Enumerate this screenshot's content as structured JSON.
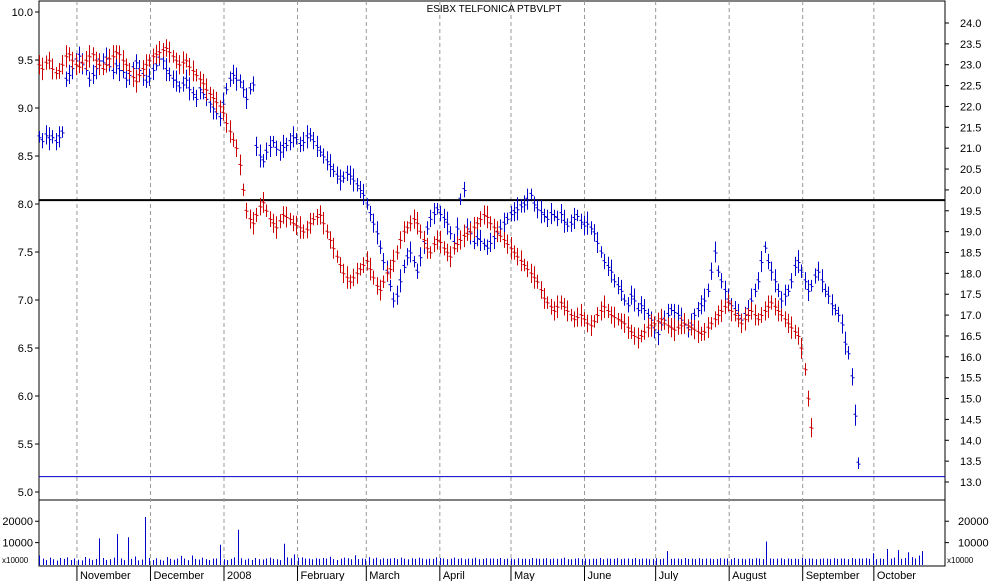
{
  "chart_data": {
    "type": "bar",
    "title": "ESIBX TELFONICA PTBVLPT",
    "x_months": [
      {
        "label": "November",
        "day": 30
      },
      {
        "label": "December",
        "day": 61
      },
      {
        "label": "2008",
        "day": 92
      },
      {
        "label": "February",
        "day": 123
      },
      {
        "label": "March",
        "day": 152
      },
      {
        "label": "April",
        "day": 183
      },
      {
        "label": "May",
        "day": 213
      },
      {
        "label": "June",
        "day": 244
      },
      {
        "label": "July",
        "day": 274
      },
      {
        "label": "August",
        "day": 305
      },
      {
        "label": "September",
        "day": 336
      },
      {
        "label": "October",
        "day": 366
      }
    ],
    "x_range_days": [
      14,
      396
    ],
    "left_axis": {
      "ylim": [
        5.0,
        10.0
      ],
      "ticks": [
        "5.0",
        "5.5",
        "6.0",
        "6.5",
        "7.0",
        "7.5",
        "8.0",
        "8.5",
        "9.0",
        "9.5",
        "10.0"
      ]
    },
    "right_axis": {
      "ylim": [
        13.0,
        24.5
      ],
      "ticks": [
        "13.0",
        "13.5",
        "14.0",
        "14.5",
        "15.0",
        "15.5",
        "16.0",
        "16.5",
        "17.0",
        "17.5",
        "18.0",
        "18.5",
        "19.0",
        "19.5",
        "20.0",
        "20.5",
        "21.0",
        "21.5",
        "22.0",
        "22.5",
        "23.0",
        "23.5",
        "24.0"
      ]
    },
    "volume": {
      "ylim": [
        0,
        29000
      ],
      "left_ticks": [
        "20000",
        "10000"
      ],
      "right_ticks": [
        "20000",
        "10000"
      ],
      "tick_values": [
        20000,
        10000
      ],
      "multiplier_label": "x10000",
      "values": [
        4000,
        2500,
        1800,
        3000,
        2200,
        1600,
        2800,
        2400,
        3100,
        1900,
        2600,
        2000,
        1700,
        3300,
        2500,
        1800,
        2400,
        12000,
        2800,
        1900,
        2200,
        3000,
        14000,
        2600,
        1800,
        12500,
        2400,
        3500,
        1700,
        2100,
        22000,
        2800,
        1900,
        2700,
        2000,
        1600,
        3200,
        2400,
        2000,
        2600,
        3800,
        2500,
        1800,
        4000,
        2400,
        2100,
        3000,
        2300,
        1900,
        2500,
        2600,
        9000,
        2200,
        1800,
        2400,
        3100,
        16000,
        2700,
        2000,
        2500,
        1900,
        2800,
        2300,
        2100,
        2600,
        3000,
        2400,
        2200,
        1800,
        9500,
        3100,
        2700,
        4500,
        2900,
        3100,
        2600,
        2500,
        2200,
        2700,
        2400,
        2800,
        2600,
        3400,
        2300,
        1900,
        2500,
        3000,
        2700,
        2200,
        4100,
        2300,
        2600,
        2400,
        3200,
        2500,
        3000,
        2200,
        2700,
        2400,
        2600,
        2800,
        2300,
        3000,
        2500,
        2200,
        2700,
        2400,
        2900,
        2600,
        2200,
        2500,
        2400,
        3100,
        2800,
        2600,
        2300,
        2500,
        3000,
        2400,
        2700,
        2200,
        2600,
        2500,
        2900,
        2300,
        2400,
        2700,
        2500,
        2600,
        2400,
        2800,
        2300,
        2500,
        2600,
        2200,
        2700,
        2400,
        2500,
        2300,
        2800,
        2600,
        2400,
        2500,
        2700,
        2300,
        2600,
        2400,
        2500,
        2900,
        2300,
        2200,
        2500,
        2700,
        2400,
        2600,
        2300,
        2500,
        2400,
        2800,
        2200,
        2600,
        2500,
        2400,
        2700,
        2300,
        2500,
        2600,
        2400,
        2800,
        2300,
        2500,
        2600,
        2200,
        2400,
        2700,
        2300,
        2500,
        6000,
        2400,
        2500,
        2600,
        2300,
        2800,
        2400,
        2500,
        2300,
        2700,
        2400,
        2600,
        2500,
        2300,
        2400,
        2700,
        2500,
        2600,
        2300,
        2800,
        2400,
        2500,
        2200,
        2600,
        2400,
        2700,
        2500,
        2300,
        10500,
        2600,
        2400,
        2500,
        2700,
        2300,
        2600,
        2400,
        2500,
        2300,
        2800,
        2400,
        2600,
        2500,
        2300,
        2400,
        2600,
        2500,
        2300,
        2700,
        2400,
        2600,
        2500,
        2300,
        2800,
        2400,
        2600,
        2500,
        2700,
        2400,
        5000,
        2300,
        2600,
        2400,
        7000,
        2500,
        3000,
        6500,
        2400,
        2800,
        5500,
        3200,
        2600,
        4000,
        6000
      ]
    },
    "reference_lines": [
      {
        "name": "resistance-line",
        "value_left": 8.04,
        "color": "#000000"
      },
      {
        "name": "current-low-line",
        "value_left": 5.16,
        "color": "#0000cc"
      }
    ],
    "series": [
      {
        "color": "#0000cc",
        "axis": "left",
        "start_day": 14,
        "step_days": 1.41,
        "values": [
          8.7,
          8.66,
          8.72,
          8.68,
          8.7,
          8.65,
          8.7,
          8.75,
          9.3,
          9.35,
          9.42,
          9.5,
          9.55,
          9.46,
          9.4,
          9.3,
          9.35,
          9.42,
          9.5,
          9.48,
          9.52,
          9.44,
          9.38,
          9.45,
          9.4,
          9.38,
          9.3,
          9.35,
          9.42,
          9.48,
          9.4,
          9.35,
          9.28,
          9.32,
          9.4,
          9.45,
          9.52,
          9.5,
          9.4,
          9.35,
          9.3,
          9.28,
          9.22,
          9.25,
          9.3,
          9.2,
          9.15,
          9.1,
          9.2,
          9.15,
          9.1,
          9.05,
          9.0,
          8.95,
          8.9,
          9.05,
          9.2,
          9.3,
          9.35,
          9.3,
          9.28,
          9.2,
          9.1,
          9.2,
          9.25,
          8.6,
          8.5,
          8.45,
          8.55,
          8.6,
          8.65,
          8.58,
          8.55,
          8.6,
          8.62,
          8.65,
          8.7,
          8.68,
          8.62,
          8.65,
          8.7,
          8.72,
          8.66,
          8.6,
          8.55,
          8.5,
          8.45,
          8.4,
          8.35,
          8.3,
          8.25,
          8.28,
          8.32,
          8.3,
          8.25,
          8.2,
          8.15,
          8.1,
          8.0,
          7.9,
          7.8,
          7.7,
          7.55,
          7.4,
          7.3,
          7.15,
          7.0,
          7.05,
          7.2,
          7.35,
          7.45,
          7.5,
          7.4,
          7.3,
          7.45,
          7.6,
          7.75,
          7.85,
          7.9,
          7.95,
          7.9,
          7.85,
          7.8,
          7.7,
          7.6,
          7.75,
          8.05,
          8.15,
          7.75,
          7.7,
          7.6,
          7.65,
          7.62,
          7.58,
          7.55,
          7.6,
          7.65,
          7.7,
          7.75,
          7.8,
          7.85,
          7.9,
          7.92,
          7.95,
          7.98,
          8.0,
          8.05,
          8.1,
          8.0,
          7.95,
          7.92,
          7.88,
          7.85,
          7.9,
          7.88,
          7.85,
          7.9,
          7.82,
          7.78,
          7.8,
          7.85,
          7.88,
          7.82,
          7.78,
          7.8,
          7.75,
          7.7,
          7.6,
          7.5,
          7.4,
          7.35,
          7.3,
          7.2,
          7.15,
          7.1,
          7.0,
          6.95,
          7.05,
          7.0,
          6.9,
          6.95,
          6.9,
          6.85,
          6.8,
          6.7,
          6.65,
          6.75,
          6.8,
          6.85,
          6.9,
          6.88,
          6.85,
          6.8,
          6.75,
          6.7,
          6.75,
          6.85,
          6.9,
          6.95,
          7.0,
          7.1,
          7.3,
          7.5,
          7.3,
          7.2,
          7.1,
          7.0,
          6.95,
          6.9,
          6.85,
          6.8,
          6.85,
          6.9,
          7.0,
          7.1,
          7.2,
          7.4,
          7.55,
          7.4,
          7.3,
          7.2,
          7.1,
          7.0,
          7.05,
          7.1,
          7.2,
          7.35,
          7.4,
          7.3,
          7.2,
          7.1,
          7.15,
          7.25,
          7.3,
          7.2,
          7.1,
          7.05,
          6.95,
          6.9,
          6.85,
          6.75,
          6.55,
          6.45,
          6.2,
          5.8,
          5.3
        ]
      },
      {
        "color": "#cc0000",
        "axis": "right",
        "start_day": 14,
        "step_days": 1.41,
        "values": [
          23.0,
          22.9,
          23.05,
          23.1,
          22.9,
          22.8,
          22.85,
          23.0,
          23.2,
          23.25,
          23.1,
          23.0,
          22.95,
          23.05,
          23.1,
          23.2,
          23.25,
          23.1,
          23.0,
          22.9,
          23.0,
          23.15,
          23.2,
          23.3,
          23.25,
          23.1,
          23.0,
          22.85,
          22.7,
          22.6,
          22.75,
          22.9,
          23.0,
          23.1,
          23.2,
          23.25,
          23.3,
          23.35,
          23.4,
          23.3,
          23.2,
          23.1,
          23.0,
          23.05,
          23.1,
          22.95,
          22.85,
          22.75,
          22.65,
          22.55,
          22.4,
          22.3,
          22.2,
          22.1,
          22.0,
          21.85,
          21.6,
          21.4,
          21.2,
          21.0,
          20.6,
          20.0,
          19.5,
          19.3,
          19.2,
          19.4,
          19.6,
          19.7,
          19.5,
          19.3,
          19.2,
          19.1,
          19.25,
          19.4,
          19.35,
          19.3,
          19.2,
          19.15,
          19.1,
          19.0,
          19.05,
          19.2,
          19.3,
          19.35,
          19.4,
          19.2,
          19.0,
          18.8,
          18.6,
          18.4,
          18.2,
          18.0,
          17.9,
          17.8,
          17.9,
          18.0,
          18.1,
          18.2,
          18.3,
          18.1,
          17.9,
          17.7,
          17.6,
          17.8,
          18.0,
          18.1,
          18.3,
          18.5,
          18.8,
          19.0,
          19.1,
          19.2,
          19.3,
          19.2,
          19.0,
          18.8,
          18.6,
          18.5,
          18.7,
          18.8,
          18.75,
          18.6,
          18.5,
          18.4,
          18.6,
          18.7,
          18.8,
          18.9,
          18.95,
          19.0,
          19.1,
          19.2,
          19.3,
          19.4,
          19.35,
          19.2,
          19.1,
          19.0,
          18.9,
          18.8,
          18.7,
          18.6,
          18.5,
          18.4,
          18.3,
          18.2,
          18.1,
          18.0,
          17.9,
          17.8,
          17.6,
          17.4,
          17.3,
          17.2,
          17.1,
          17.2,
          17.3,
          17.2,
          17.1,
          17.0,
          16.9,
          16.95,
          17.0,
          16.9,
          16.8,
          16.75,
          16.85,
          17.0,
          17.1,
          17.2,
          17.1,
          17.0,
          16.95,
          16.9,
          16.85,
          16.8,
          16.7,
          16.6,
          16.5,
          16.45,
          16.5,
          16.6,
          16.7,
          16.75,
          16.8,
          16.85,
          16.9,
          16.8,
          16.75,
          16.7,
          16.65,
          16.7,
          16.75,
          16.8,
          16.75,
          16.7,
          16.65,
          16.6,
          16.55,
          16.6,
          16.7,
          16.8,
          16.9,
          17.0,
          17.1,
          17.2,
          17.3,
          17.1,
          17.0,
          16.9,
          16.8,
          16.9,
          17.0,
          17.1,
          17.0,
          16.9,
          17.0,
          17.1,
          17.2,
          17.3,
          17.2,
          17.1,
          17.0,
          16.9,
          16.8,
          16.7,
          16.6,
          16.5,
          16.2,
          15.7,
          15.0,
          14.3
        ]
      }
    ]
  }
}
